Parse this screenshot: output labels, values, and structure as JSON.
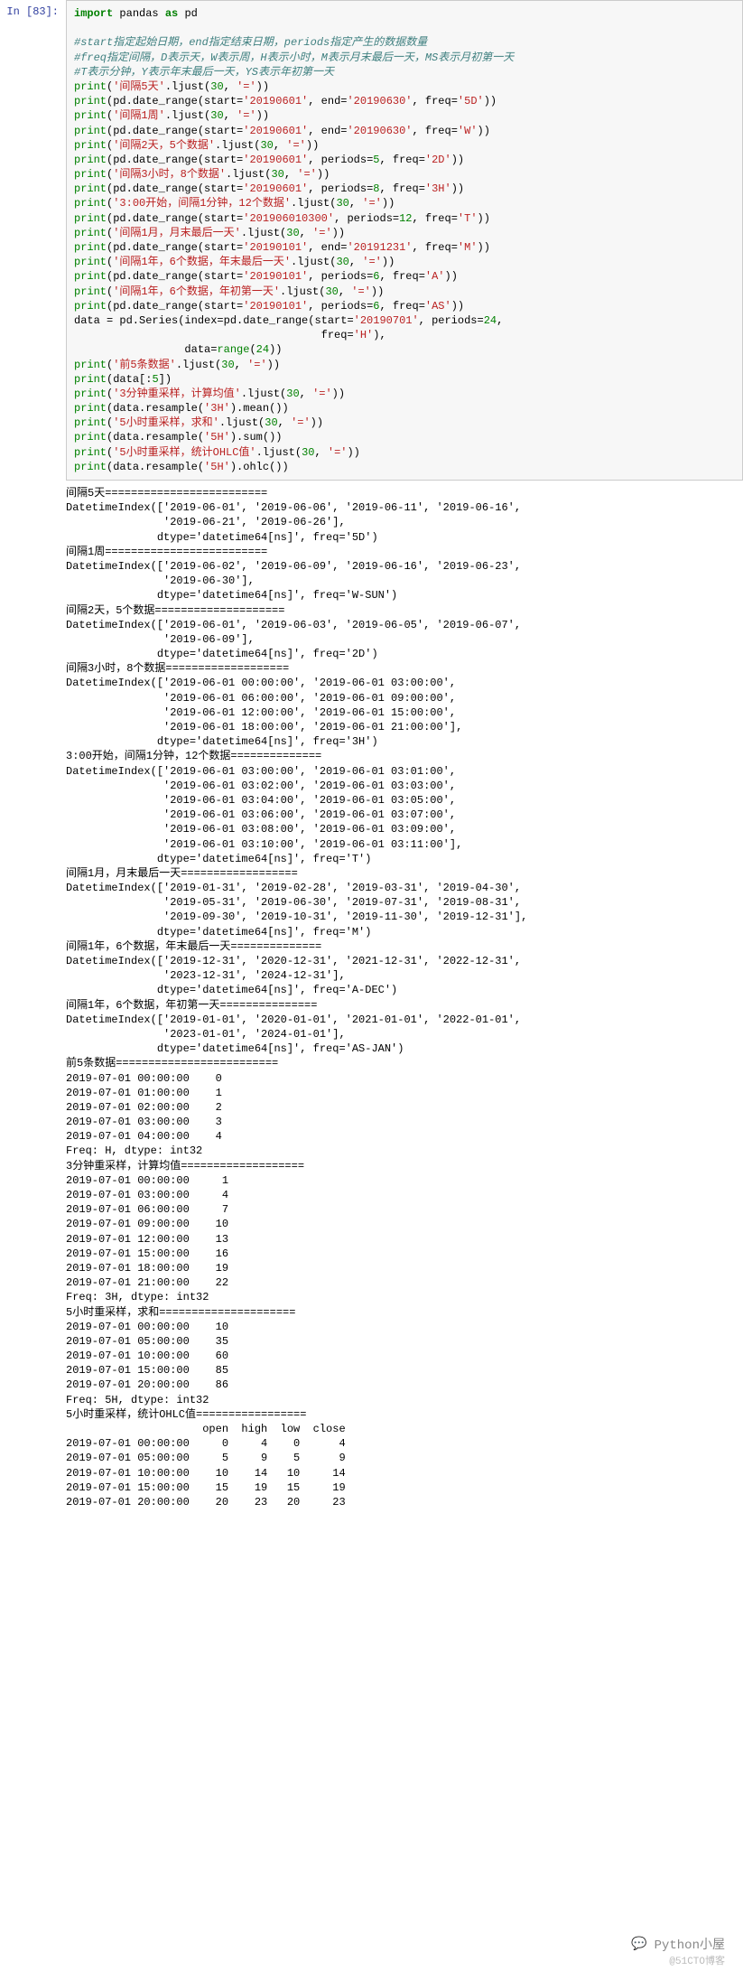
{
  "prompt": "In  [83]:",
  "code_lines": [
    [
      {
        "t": "import ",
        "c": "kw"
      },
      {
        "t": "pandas ",
        "c": ""
      },
      {
        "t": "as ",
        "c": "kw"
      },
      {
        "t": "pd",
        "c": ""
      }
    ],
    [
      {
        "t": "",
        "c": ""
      }
    ],
    [
      {
        "t": "#start指定起始日期，end指定结束日期，periods指定产生的数据数量",
        "c": "cmt"
      }
    ],
    [
      {
        "t": "#freq指定间隔，D表示天，W表示周，H表示小时，M表示月末最后一天，MS表示月初第一天",
        "c": "cmt"
      }
    ],
    [
      {
        "t": "#T表示分钟，Y表示年末最后一天，YS表示年初第一天",
        "c": "cmt"
      }
    ],
    [
      {
        "t": "print",
        "c": "fn"
      },
      {
        "t": "(",
        "c": ""
      },
      {
        "t": "'间隔5天'",
        "c": "str"
      },
      {
        "t": ".",
        "c": ""
      },
      {
        "t": "ljust",
        "c": ""
      },
      {
        "t": "(",
        "c": ""
      },
      {
        "t": "30",
        "c": "num"
      },
      {
        "t": ", ",
        "c": ""
      },
      {
        "t": "'='",
        "c": "str"
      },
      {
        "t": "))",
        "c": ""
      }
    ],
    [
      {
        "t": "print",
        "c": "fn"
      },
      {
        "t": "(pd.date_range(start=",
        "c": ""
      },
      {
        "t": "'20190601'",
        "c": "str"
      },
      {
        "t": ", end=",
        "c": ""
      },
      {
        "t": "'20190630'",
        "c": "str"
      },
      {
        "t": ", freq=",
        "c": ""
      },
      {
        "t": "'5D'",
        "c": "str"
      },
      {
        "t": "))",
        "c": ""
      }
    ],
    [
      {
        "t": "print",
        "c": "fn"
      },
      {
        "t": "(",
        "c": ""
      },
      {
        "t": "'间隔1周'",
        "c": "str"
      },
      {
        "t": ".ljust(",
        "c": ""
      },
      {
        "t": "30",
        "c": "num"
      },
      {
        "t": ", ",
        "c": ""
      },
      {
        "t": "'='",
        "c": "str"
      },
      {
        "t": "))",
        "c": ""
      }
    ],
    [
      {
        "t": "print",
        "c": "fn"
      },
      {
        "t": "(pd.date_range(start=",
        "c": ""
      },
      {
        "t": "'20190601'",
        "c": "str"
      },
      {
        "t": ", end=",
        "c": ""
      },
      {
        "t": "'20190630'",
        "c": "str"
      },
      {
        "t": ", freq=",
        "c": ""
      },
      {
        "t": "'W'",
        "c": "str"
      },
      {
        "t": "))",
        "c": ""
      }
    ],
    [
      {
        "t": "print",
        "c": "fn"
      },
      {
        "t": "(",
        "c": ""
      },
      {
        "t": "'间隔2天，5个数据'",
        "c": "str"
      },
      {
        "t": ".ljust(",
        "c": ""
      },
      {
        "t": "30",
        "c": "num"
      },
      {
        "t": ", ",
        "c": ""
      },
      {
        "t": "'='",
        "c": "str"
      },
      {
        "t": "))",
        "c": ""
      }
    ],
    [
      {
        "t": "print",
        "c": "fn"
      },
      {
        "t": "(pd.date_range(start=",
        "c": ""
      },
      {
        "t": "'20190601'",
        "c": "str"
      },
      {
        "t": ", periods=",
        "c": ""
      },
      {
        "t": "5",
        "c": "num"
      },
      {
        "t": ", freq=",
        "c": ""
      },
      {
        "t": "'2D'",
        "c": "str"
      },
      {
        "t": "))",
        "c": ""
      }
    ],
    [
      {
        "t": "print",
        "c": "fn"
      },
      {
        "t": "(",
        "c": ""
      },
      {
        "t": "'间隔3小时，8个数据'",
        "c": "str"
      },
      {
        "t": ".ljust(",
        "c": ""
      },
      {
        "t": "30",
        "c": "num"
      },
      {
        "t": ", ",
        "c": ""
      },
      {
        "t": "'='",
        "c": "str"
      },
      {
        "t": "))",
        "c": ""
      }
    ],
    [
      {
        "t": "print",
        "c": "fn"
      },
      {
        "t": "(pd.date_range(start=",
        "c": ""
      },
      {
        "t": "'20190601'",
        "c": "str"
      },
      {
        "t": ", periods=",
        "c": ""
      },
      {
        "t": "8",
        "c": "num"
      },
      {
        "t": ", freq=",
        "c": ""
      },
      {
        "t": "'3H'",
        "c": "str"
      },
      {
        "t": "))",
        "c": ""
      }
    ],
    [
      {
        "t": "print",
        "c": "fn"
      },
      {
        "t": "(",
        "c": ""
      },
      {
        "t": "'3:00开始，间隔1分钟，12个数据'",
        "c": "str"
      },
      {
        "t": ".ljust(",
        "c": ""
      },
      {
        "t": "30",
        "c": "num"
      },
      {
        "t": ", ",
        "c": ""
      },
      {
        "t": "'='",
        "c": "str"
      },
      {
        "t": "))",
        "c": ""
      }
    ],
    [
      {
        "t": "print",
        "c": "fn"
      },
      {
        "t": "(pd.date_range(start=",
        "c": ""
      },
      {
        "t": "'201906010300'",
        "c": "str"
      },
      {
        "t": ", periods=",
        "c": ""
      },
      {
        "t": "12",
        "c": "num"
      },
      {
        "t": ", freq=",
        "c": ""
      },
      {
        "t": "'T'",
        "c": "str"
      },
      {
        "t": "))",
        "c": ""
      }
    ],
    [
      {
        "t": "print",
        "c": "fn"
      },
      {
        "t": "(",
        "c": ""
      },
      {
        "t": "'间隔1月，月末最后一天'",
        "c": "str"
      },
      {
        "t": ".ljust(",
        "c": ""
      },
      {
        "t": "30",
        "c": "num"
      },
      {
        "t": ", ",
        "c": ""
      },
      {
        "t": "'='",
        "c": "str"
      },
      {
        "t": "))",
        "c": ""
      }
    ],
    [
      {
        "t": "print",
        "c": "fn"
      },
      {
        "t": "(pd.date_range(start=",
        "c": ""
      },
      {
        "t": "'20190101'",
        "c": "str"
      },
      {
        "t": ", end=",
        "c": ""
      },
      {
        "t": "'20191231'",
        "c": "str"
      },
      {
        "t": ", freq=",
        "c": ""
      },
      {
        "t": "'M'",
        "c": "str"
      },
      {
        "t": "))",
        "c": ""
      }
    ],
    [
      {
        "t": "print",
        "c": "fn"
      },
      {
        "t": "(",
        "c": ""
      },
      {
        "t": "'间隔1年，6个数据，年末最后一天'",
        "c": "str"
      },
      {
        "t": ".ljust(",
        "c": ""
      },
      {
        "t": "30",
        "c": "num"
      },
      {
        "t": ", ",
        "c": ""
      },
      {
        "t": "'='",
        "c": "str"
      },
      {
        "t": "))",
        "c": ""
      }
    ],
    [
      {
        "t": "print",
        "c": "fn"
      },
      {
        "t": "(pd.date_range(start=",
        "c": ""
      },
      {
        "t": "'20190101'",
        "c": "str"
      },
      {
        "t": ", periods=",
        "c": ""
      },
      {
        "t": "6",
        "c": "num"
      },
      {
        "t": ", freq=",
        "c": ""
      },
      {
        "t": "'A'",
        "c": "str"
      },
      {
        "t": "))",
        "c": ""
      }
    ],
    [
      {
        "t": "print",
        "c": "fn"
      },
      {
        "t": "(",
        "c": ""
      },
      {
        "t": "'间隔1年，6个数据，年初第一天'",
        "c": "str"
      },
      {
        "t": ".ljust(",
        "c": ""
      },
      {
        "t": "30",
        "c": "num"
      },
      {
        "t": ", ",
        "c": ""
      },
      {
        "t": "'='",
        "c": "str"
      },
      {
        "t": "))",
        "c": ""
      }
    ],
    [
      {
        "t": "print",
        "c": "fn"
      },
      {
        "t": "(pd.date_range(start=",
        "c": ""
      },
      {
        "t": "'20190101'",
        "c": "str"
      },
      {
        "t": ", periods=",
        "c": ""
      },
      {
        "t": "6",
        "c": "num"
      },
      {
        "t": ", freq=",
        "c": ""
      },
      {
        "t": "'AS'",
        "c": "str"
      },
      {
        "t": "))",
        "c": ""
      }
    ],
    [
      {
        "t": "data = pd.Series(index=pd.date_range(start=",
        "c": ""
      },
      {
        "t": "'20190701'",
        "c": "str"
      },
      {
        "t": ", periods=",
        "c": ""
      },
      {
        "t": "24",
        "c": "num"
      },
      {
        "t": ",",
        "c": ""
      }
    ],
    [
      {
        "t": "                                      freq=",
        "c": ""
      },
      {
        "t": "'H'",
        "c": "str"
      },
      {
        "t": "),",
        "c": ""
      }
    ],
    [
      {
        "t": "                 data=",
        "c": ""
      },
      {
        "t": "range",
        "c": "bi"
      },
      {
        "t": "(",
        "c": ""
      },
      {
        "t": "24",
        "c": "num"
      },
      {
        "t": "))",
        "c": ""
      }
    ],
    [
      {
        "t": "print",
        "c": "fn"
      },
      {
        "t": "(",
        "c": ""
      },
      {
        "t": "'前5条数据'",
        "c": "str"
      },
      {
        "t": ".ljust(",
        "c": ""
      },
      {
        "t": "30",
        "c": "num"
      },
      {
        "t": ", ",
        "c": ""
      },
      {
        "t": "'='",
        "c": "str"
      },
      {
        "t": "))",
        "c": ""
      }
    ],
    [
      {
        "t": "print",
        "c": "fn"
      },
      {
        "t": "(data[:",
        "c": ""
      },
      {
        "t": "5",
        "c": "num"
      },
      {
        "t": "])",
        "c": ""
      }
    ],
    [
      {
        "t": "print",
        "c": "fn"
      },
      {
        "t": "(",
        "c": ""
      },
      {
        "t": "'3分钟重采样，计算均值'",
        "c": "str"
      },
      {
        "t": ".ljust(",
        "c": ""
      },
      {
        "t": "30",
        "c": "num"
      },
      {
        "t": ", ",
        "c": ""
      },
      {
        "t": "'='",
        "c": "str"
      },
      {
        "t": "))",
        "c": ""
      }
    ],
    [
      {
        "t": "print",
        "c": "fn"
      },
      {
        "t": "(data.resample(",
        "c": ""
      },
      {
        "t": "'3H'",
        "c": "str"
      },
      {
        "t": ").mean())",
        "c": ""
      }
    ],
    [
      {
        "t": "print",
        "c": "fn"
      },
      {
        "t": "(",
        "c": ""
      },
      {
        "t": "'5小时重采样，求和'",
        "c": "str"
      },
      {
        "t": ".ljust(",
        "c": ""
      },
      {
        "t": "30",
        "c": "num"
      },
      {
        "t": ", ",
        "c": ""
      },
      {
        "t": "'='",
        "c": "str"
      },
      {
        "t": "))",
        "c": ""
      }
    ],
    [
      {
        "t": "print",
        "c": "fn"
      },
      {
        "t": "(data.resample(",
        "c": ""
      },
      {
        "t": "'5H'",
        "c": "str"
      },
      {
        "t": ").sum())",
        "c": ""
      }
    ],
    [
      {
        "t": "print",
        "c": "fn"
      },
      {
        "t": "(",
        "c": ""
      },
      {
        "t": "'5小时重采样，统计OHLC值'",
        "c": "str"
      },
      {
        "t": ".ljust(",
        "c": ""
      },
      {
        "t": "30",
        "c": "num"
      },
      {
        "t": ", ",
        "c": ""
      },
      {
        "t": "'='",
        "c": "str"
      },
      {
        "t": "))",
        "c": ""
      }
    ],
    [
      {
        "t": "print",
        "c": "fn"
      },
      {
        "t": "(data.resample(",
        "c": ""
      },
      {
        "t": "'5H'",
        "c": "str"
      },
      {
        "t": ").ohlc())",
        "c": ""
      }
    ]
  ],
  "output": "间隔5天=========================\nDatetimeIndex(['2019-06-01', '2019-06-06', '2019-06-11', '2019-06-16',\n               '2019-06-21', '2019-06-26'],\n              dtype='datetime64[ns]', freq='5D')\n间隔1周=========================\nDatetimeIndex(['2019-06-02', '2019-06-09', '2019-06-16', '2019-06-23',\n               '2019-06-30'],\n              dtype='datetime64[ns]', freq='W-SUN')\n间隔2天，5个数据====================\nDatetimeIndex(['2019-06-01', '2019-06-03', '2019-06-05', '2019-06-07',\n               '2019-06-09'],\n              dtype='datetime64[ns]', freq='2D')\n间隔3小时，8个数据===================\nDatetimeIndex(['2019-06-01 00:00:00', '2019-06-01 03:00:00',\n               '2019-06-01 06:00:00', '2019-06-01 09:00:00',\n               '2019-06-01 12:00:00', '2019-06-01 15:00:00',\n               '2019-06-01 18:00:00', '2019-06-01 21:00:00'],\n              dtype='datetime64[ns]', freq='3H')\n3:00开始，间隔1分钟，12个数据==============\nDatetimeIndex(['2019-06-01 03:00:00', '2019-06-01 03:01:00',\n               '2019-06-01 03:02:00', '2019-06-01 03:03:00',\n               '2019-06-01 03:04:00', '2019-06-01 03:05:00',\n               '2019-06-01 03:06:00', '2019-06-01 03:07:00',\n               '2019-06-01 03:08:00', '2019-06-01 03:09:00',\n               '2019-06-01 03:10:00', '2019-06-01 03:11:00'],\n              dtype='datetime64[ns]', freq='T')\n间隔1月，月末最后一天==================\nDatetimeIndex(['2019-01-31', '2019-02-28', '2019-03-31', '2019-04-30',\n               '2019-05-31', '2019-06-30', '2019-07-31', '2019-08-31',\n               '2019-09-30', '2019-10-31', '2019-11-30', '2019-12-31'],\n              dtype='datetime64[ns]', freq='M')\n间隔1年，6个数据，年末最后一天==============\nDatetimeIndex(['2019-12-31', '2020-12-31', '2021-12-31', '2022-12-31',\n               '2023-12-31', '2024-12-31'],\n              dtype='datetime64[ns]', freq='A-DEC')\n间隔1年，6个数据，年初第一天===============\nDatetimeIndex(['2019-01-01', '2020-01-01', '2021-01-01', '2022-01-01',\n               '2023-01-01', '2024-01-01'],\n              dtype='datetime64[ns]', freq='AS-JAN')\n前5条数据=========================\n2019-07-01 00:00:00    0\n2019-07-01 01:00:00    1\n2019-07-01 02:00:00    2\n2019-07-01 03:00:00    3\n2019-07-01 04:00:00    4\nFreq: H, dtype: int32\n3分钟重采样，计算均值===================\n2019-07-01 00:00:00     1\n2019-07-01 03:00:00     4\n2019-07-01 06:00:00     7\n2019-07-01 09:00:00    10\n2019-07-01 12:00:00    13\n2019-07-01 15:00:00    16\n2019-07-01 18:00:00    19\n2019-07-01 21:00:00    22\nFreq: 3H, dtype: int32\n5小时重采样，求和=====================\n2019-07-01 00:00:00    10\n2019-07-01 05:00:00    35\n2019-07-01 10:00:00    60\n2019-07-01 15:00:00    85\n2019-07-01 20:00:00    86\nFreq: 5H, dtype: int32\n5小时重采样，统计OHLC值=================\n                     open  high  low  close\n2019-07-01 00:00:00     0     4    0      4\n2019-07-01 05:00:00     5     9    5      9\n2019-07-01 10:00:00    10    14   10     14\n2019-07-01 15:00:00    15    19   15     19\n2019-07-01 20:00:00    20    23   20     23",
  "watermark1": "Python小屋",
  "watermark2": "@51CTO博客"
}
